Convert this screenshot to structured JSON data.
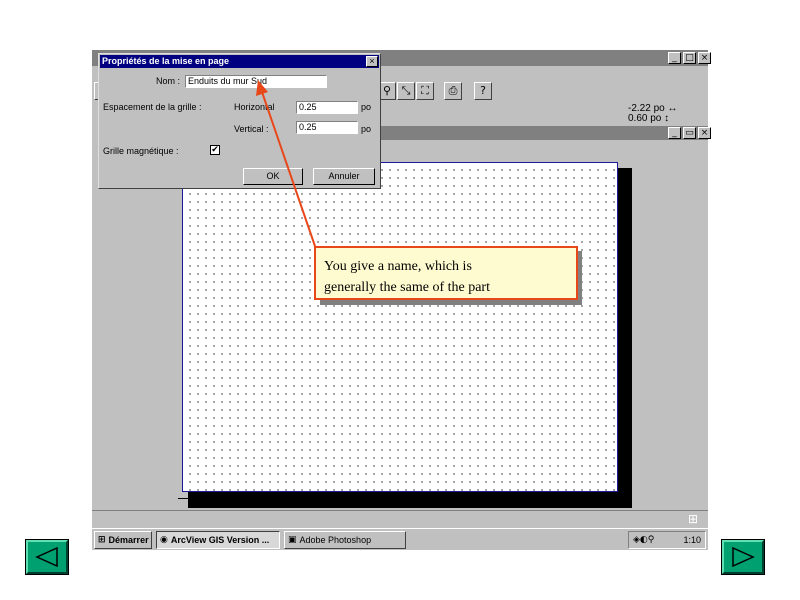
{
  "dialog": {
    "title": "Propriétés de la mise en page",
    "close_glyph": "×",
    "name_label": "Nom :",
    "name_value": "Enduits du mur Sud",
    "grid_spacing_label": "Espacement de la grille :",
    "horizontal_label": "Horizontal",
    "horizontal_value": "0.25",
    "vertical_label": "Vertical :",
    "vertical_value": "0.25",
    "unit_label": "po",
    "magnetic_grid_label": "Grille magnétique :",
    "magnetic_grid_checked": true,
    "check_glyph": "✔",
    "ok_label": "OK",
    "cancel_label": "Annuler"
  },
  "app_window": {
    "buttons": [
      "_",
      "□",
      "×"
    ],
    "layout_buttons": [
      "_",
      "▭",
      "×"
    ],
    "toolbar_icons": [
      "zoom-icon",
      "zoom-full-icon",
      "zoom-extent-icon",
      "print-icon",
      "help-icon"
    ],
    "coord_x": "-2.22 po ↔",
    "coord_y": "0.60 po ↕"
  },
  "callout": {
    "line1": "You give a name, which is",
    "line2": "generally the same of the part",
    "border_color": "#e8471a",
    "fill_color": "#fffbd0"
  },
  "taskbar": {
    "start_label": "Démarrer",
    "task1_label": "ArcView GIS Version ...",
    "task2_label": "Adobe Photoshop",
    "clock": "1:10"
  },
  "nav": {
    "prev_icon": "prev-slide-icon",
    "next_icon": "next-slide-icon",
    "color": "#00a070"
  }
}
